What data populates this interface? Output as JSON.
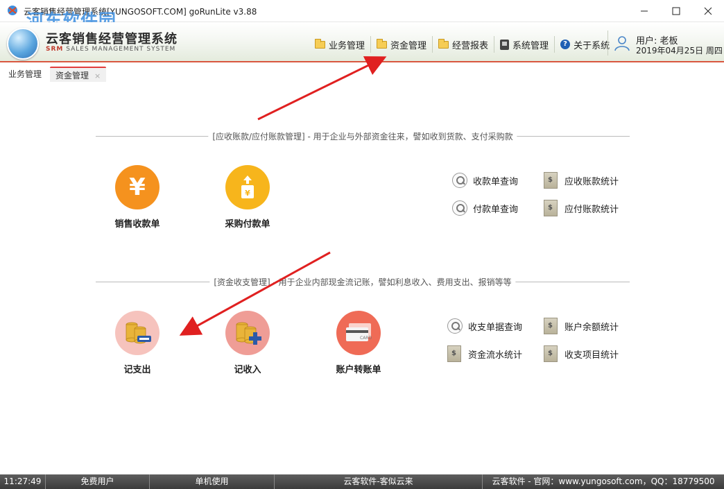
{
  "window": {
    "title": "云客销售经营管理系统[YUNGOSOFT.COM]  goRunLite v3.88",
    "watermark": "河东软件园"
  },
  "logo": {
    "title": "云客销售经营管理系统",
    "sub_brand": "SRM",
    "sub_text": "SALES MANAGEMENT SYSTEM"
  },
  "nav": {
    "items": [
      {
        "label": "业务管理",
        "icon": "folder-icon"
      },
      {
        "label": "资金管理",
        "icon": "folder-icon"
      },
      {
        "label": "经营报表",
        "icon": "folder-icon"
      },
      {
        "label": "系统管理",
        "icon": "system-icon"
      },
      {
        "label": "关于系统",
        "icon": "help-icon"
      }
    ]
  },
  "user": {
    "name": "用户: 老板",
    "date": "2019年04月25日 周四"
  },
  "tabs": [
    {
      "label": "业务管理"
    },
    {
      "label": "资金管理",
      "close": "×"
    }
  ],
  "section1": {
    "caption": "[应收账款/应付账款管理] - 用于企业与外部资金往来，譬如收到货款、支付采购款",
    "big": [
      {
        "label": "销售收款单",
        "icon": "yuan-icon",
        "color": "#f5921e"
      },
      {
        "label": "采购付款单",
        "icon": "payment-doc-icon",
        "color": "#f7b51c"
      }
    ],
    "small": [
      {
        "label": "收款单查询",
        "icon": "magnifier-icon"
      },
      {
        "label": "应收账款统计",
        "icon": "report-icon"
      },
      {
        "label": "付款单查询",
        "icon": "magnifier-icon"
      },
      {
        "label": "应付账款统计",
        "icon": "report-icon"
      }
    ]
  },
  "section2": {
    "caption": "[资金收支管理] - 用于企业内部现金流记账，譬如利息收入、费用支出、报销等等",
    "big": [
      {
        "label": "记支出",
        "icon": "coins-minus-icon",
        "color": "#f6c3bd"
      },
      {
        "label": "记收入",
        "icon": "coins-plus-icon",
        "color": "#ef9d96"
      },
      {
        "label": "账户转账单",
        "icon": "card-icon",
        "color": "#ef6b56",
        "card_text": "CARD"
      }
    ],
    "small": [
      {
        "label": "收支单据查询",
        "icon": "magnifier-icon"
      },
      {
        "label": "账户余额统计",
        "icon": "report-icon"
      },
      {
        "label": "资金流水统计",
        "icon": "report-icon"
      },
      {
        "label": "收支项目统计",
        "icon": "report-icon"
      }
    ]
  },
  "statusbar": {
    "time": "11:27:49",
    "user_type": "免费用户",
    "mode": "单机使用",
    "slogan": "云客软件-客似云来",
    "contact": "云客软件 - 官网：www.yungosoft.com，QQ：18779500"
  }
}
